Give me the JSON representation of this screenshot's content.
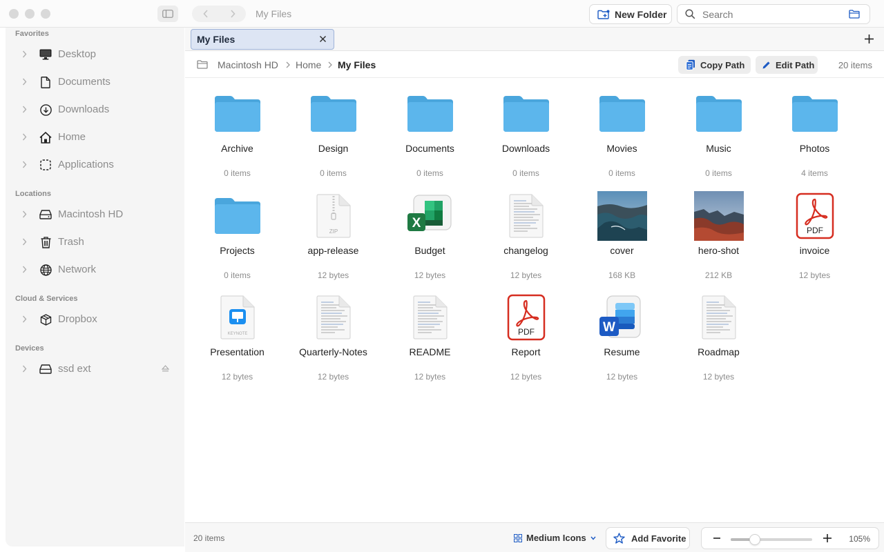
{
  "window": {
    "title": "My Files"
  },
  "toolbar": {
    "new_folder_label": "New Folder",
    "search_placeholder": "Search",
    "search_value": ""
  },
  "sidebar": {
    "sections": [
      {
        "title": "Favorites",
        "items": [
          {
            "label": "Desktop",
            "icon": "desktop-icon"
          },
          {
            "label": "Documents",
            "icon": "document-icon"
          },
          {
            "label": "Downloads",
            "icon": "download-icon"
          },
          {
            "label": "Home",
            "icon": "home-icon"
          },
          {
            "label": "Applications",
            "icon": "applications-icon"
          }
        ]
      },
      {
        "title": "Locations",
        "items": [
          {
            "label": "Macintosh HD",
            "icon": "drive-icon"
          },
          {
            "label": "Trash",
            "icon": "trash-icon"
          },
          {
            "label": "Network",
            "icon": "globe-icon"
          }
        ]
      },
      {
        "title": "Cloud & Services",
        "items": [
          {
            "label": "Dropbox",
            "icon": "box-icon"
          }
        ]
      },
      {
        "title": "Devices",
        "items": [
          {
            "label": "ssd ext",
            "icon": "external-drive-icon",
            "eject": true
          }
        ]
      }
    ]
  },
  "tabs": [
    {
      "label": "My Files",
      "active": true
    }
  ],
  "path": {
    "crumbs": [
      "Macintosh HD",
      "Home",
      "My Files"
    ],
    "copy_path_label": "Copy Path",
    "edit_path_label": "Edit Path",
    "item_count": "20 items"
  },
  "files": [
    {
      "name": "Archive",
      "sub": "0 items",
      "kind": "folder"
    },
    {
      "name": "Design",
      "sub": "0 items",
      "kind": "folder"
    },
    {
      "name": "Documents",
      "sub": "0 items",
      "kind": "folder"
    },
    {
      "name": "Downloads",
      "sub": "0 items",
      "kind": "folder"
    },
    {
      "name": "Movies",
      "sub": "0 items",
      "kind": "folder"
    },
    {
      "name": "Music",
      "sub": "0 items",
      "kind": "folder"
    },
    {
      "name": "Photos",
      "sub": "4 items",
      "kind": "folder"
    },
    {
      "name": "Projects",
      "sub": "0 items",
      "kind": "folder"
    },
    {
      "name": "app-release",
      "sub": "12 bytes",
      "kind": "zip",
      "badge": "ZIP"
    },
    {
      "name": "Budget",
      "sub": "12 bytes",
      "kind": "excel",
      "badge": "X"
    },
    {
      "name": "changelog",
      "sub": "12 bytes",
      "kind": "text"
    },
    {
      "name": "cover",
      "sub": "168 KB",
      "kind": "image-coast"
    },
    {
      "name": "hero-shot",
      "sub": "212 KB",
      "kind": "image-cliff"
    },
    {
      "name": "invoice",
      "sub": "12 bytes",
      "kind": "pdf",
      "badge": "PDF"
    },
    {
      "name": "Presentation",
      "sub": "12 bytes",
      "kind": "keynote",
      "badge": "KEYNOTE"
    },
    {
      "name": "Quarterly-Notes",
      "sub": "12 bytes",
      "kind": "text"
    },
    {
      "name": "README",
      "sub": "12 bytes",
      "kind": "text"
    },
    {
      "name": "Report",
      "sub": "12 bytes",
      "kind": "pdf",
      "badge": "PDF"
    },
    {
      "name": "Resume",
      "sub": "12 bytes",
      "kind": "word",
      "badge": "W"
    },
    {
      "name": "Roadmap",
      "sub": "12 bytes",
      "kind": "text"
    }
  ],
  "statusbar": {
    "item_count": "20 items",
    "view_mode_label": "Medium Icons",
    "add_favorite_label": "Add Favorite",
    "zoom_level": "105%",
    "zoom_fraction": 0.3
  },
  "colors": {
    "folder": "#5cb6ec",
    "folder_dark": "#4aa6dd",
    "tab_active_bg": "#dde5f4",
    "pdf_red": "#d62d20",
    "excel_green": "#1f7a43",
    "word_blue": "#1d5bc4"
  }
}
